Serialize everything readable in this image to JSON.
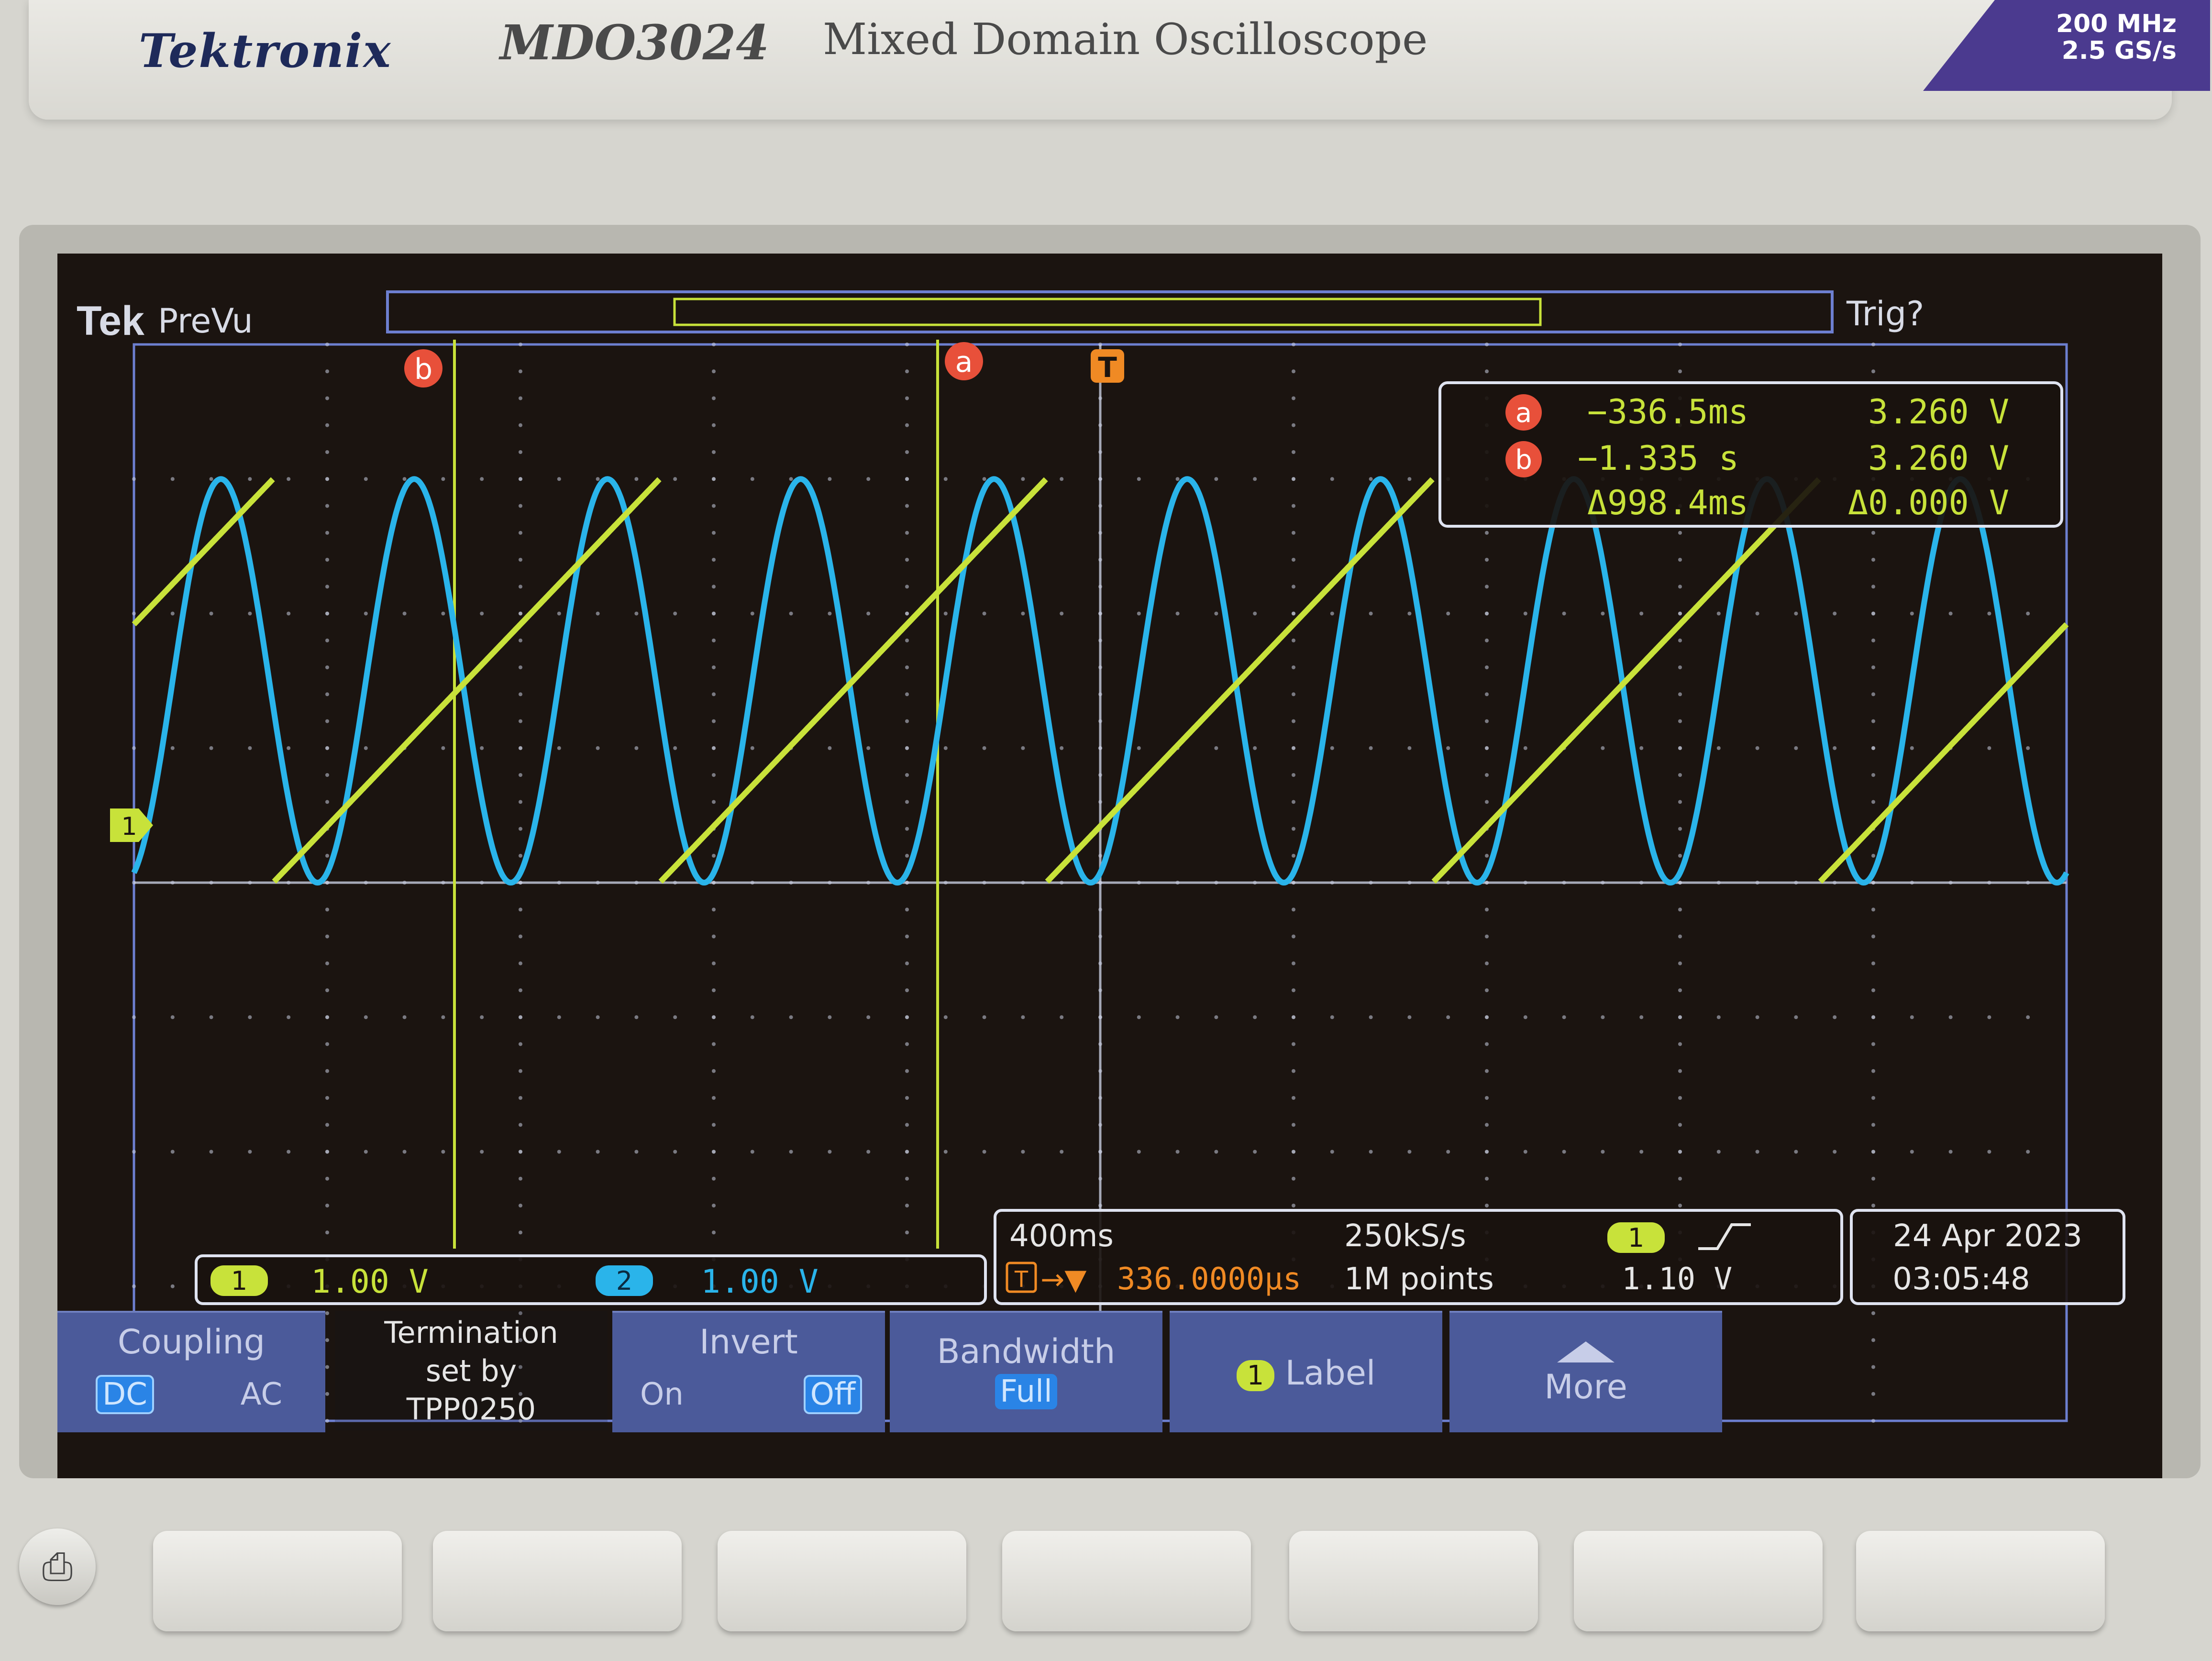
{
  "device": {
    "brand": "Tektronix",
    "model": "MDO3024",
    "description": "Mixed Domain Oscilloscope",
    "bandwidth": "200 MHz",
    "sample_rate_max": "2.5 GS/s"
  },
  "screen": {
    "tek_logo": "Tek",
    "mode": "PreVu",
    "trigger_status": "Trig?",
    "cursor_a_marker": "a",
    "cursor_b_marker": "b",
    "trigger_marker": "T",
    "channel_marker": "1",
    "cursor_readout": {
      "a_time": "−336.5ms",
      "a_volt": "3.260 V",
      "b_time": "−1.335 s",
      "b_volt": "3.260 V",
      "delta_time": "Δ998.4ms",
      "delta_volt": "Δ0.000 V"
    },
    "channels": {
      "ch1_num": "1",
      "ch1_scale": "1.00 V",
      "ch2_num": "2",
      "ch2_scale": "1.00 V"
    },
    "timebase": {
      "scale": "400ms",
      "trigger_pos": "336.0000μs",
      "sample_rate": "250kS/s",
      "record_length": "1M points",
      "trig_source": "1",
      "trig_level": "1.10 V"
    },
    "datetime": {
      "date": "24 Apr  2023",
      "time": "03:05:48"
    },
    "colors": {
      "ch1": "#c8e23a",
      "ch2": "#2ab4ea",
      "graticule": "#c8cde0"
    }
  },
  "softkeys": {
    "coupling_title": "Coupling",
    "coupling_dc": "DC",
    "coupling_ac": "AC",
    "termination_l1": "Termination",
    "termination_l2": "set by",
    "termination_l3": "TPP0250",
    "invert_title": "Invert",
    "invert_on": "On",
    "invert_off": "Off",
    "bandwidth_title": "Bandwidth",
    "bandwidth_value": "Full",
    "label_num": "1",
    "label_title": "Label",
    "more_title": "More"
  },
  "chart_data": [
    {
      "type": "line",
      "series": [
        {
          "name": "",
          "color": "#2ab4ea",
          "shape": "sine",
          "period_divisions": 1.0,
          "min_div": 0.0,
          "max_div": 3.0
        },
        {
          "name": "",
          "color": "#c8e23a",
          "shape": "sawtooth",
          "period_divisions": 2.0,
          "min_div": 0.0,
          "max_div": 3.0
        }
      ],
      "x_divisions": 10,
      "y_divisions": 8,
      "grid": true
    }
  ]
}
